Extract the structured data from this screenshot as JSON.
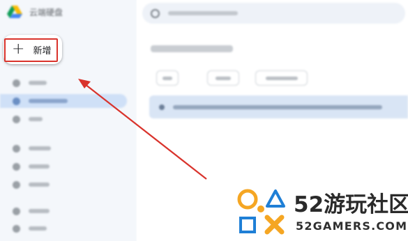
{
  "app": {
    "title": "云端硬盘"
  },
  "sidebar": {
    "new_button": {
      "icon": "plus-icon",
      "label": "新增"
    },
    "items": [
      {
        "icon": "home-icon"
      },
      {
        "icon": "my-drive-icon",
        "active": true
      },
      {
        "icon": "computers-icon"
      },
      {
        "icon": "shared-icon"
      },
      {
        "icon": "recent-icon"
      },
      {
        "icon": "starred-icon"
      },
      {
        "icon": "spam-icon"
      },
      {
        "icon": "trash-icon"
      }
    ]
  },
  "search": {
    "icon": "search-icon"
  },
  "main": {
    "page_title": "我的云端硬盘"
  },
  "watermark": {
    "brand": "52游玩社区",
    "site": "52GAMERS.COM",
    "colors": {
      "circle": "#f5a623",
      "triangle": "#1f7fd6",
      "square": "#1f7fd6",
      "x": "#f5a623"
    }
  },
  "annotation": {
    "arrow_color": "#d9332c",
    "box_color": "#d9332c"
  }
}
